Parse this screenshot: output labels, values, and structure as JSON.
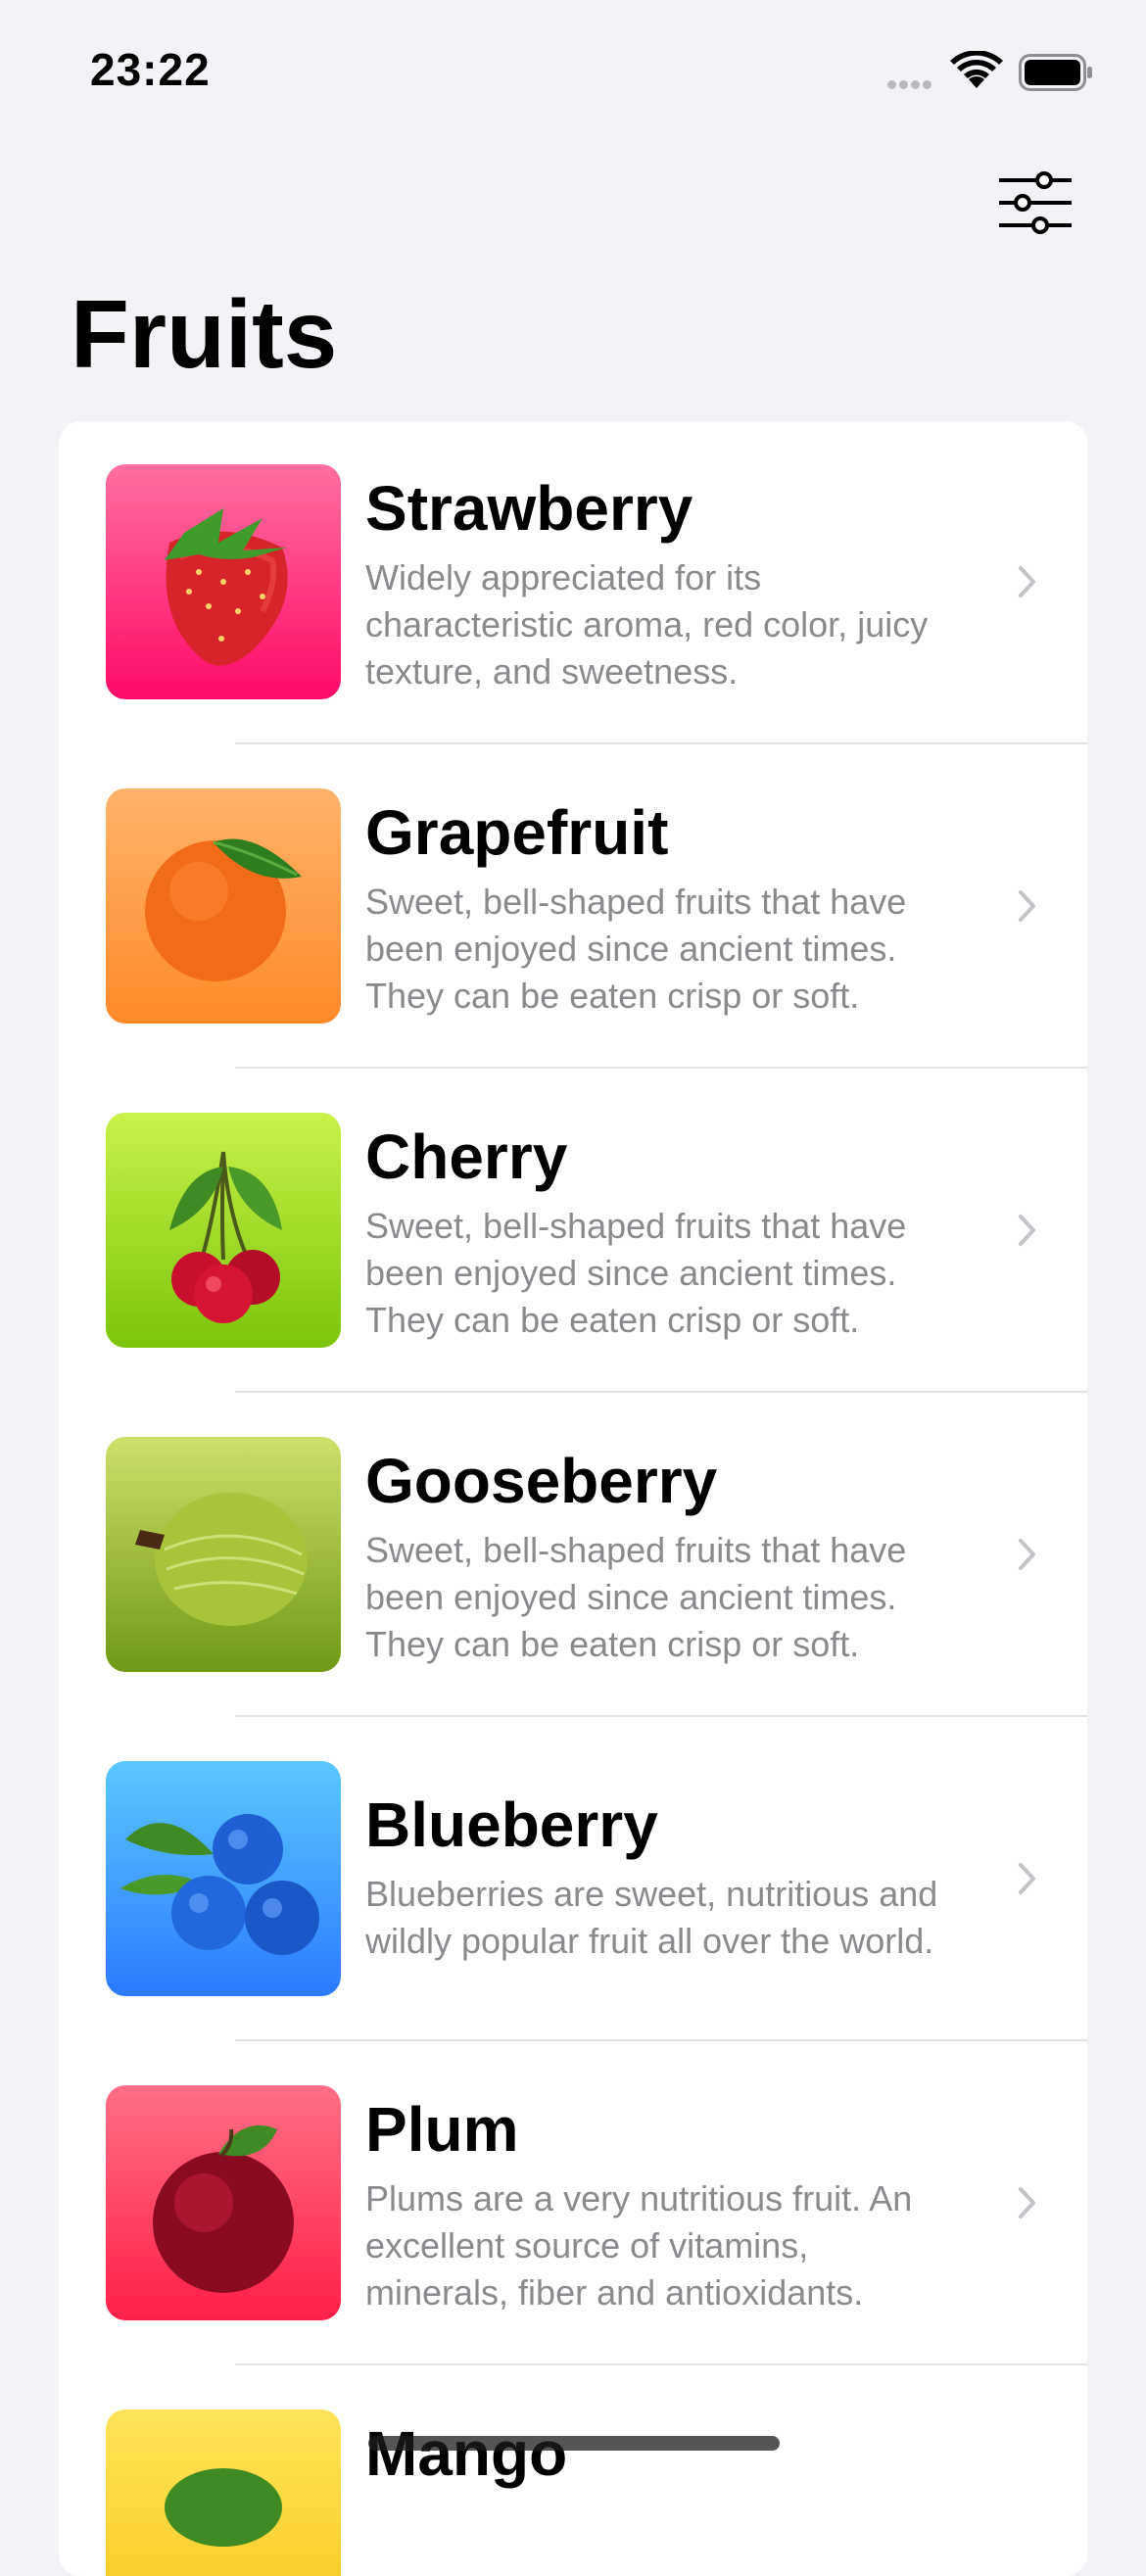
{
  "status_bar": {
    "time": "23:22"
  },
  "header": {
    "title": "Fruits",
    "filter_icon": "sliders-icon"
  },
  "accent_colors": {
    "strawberry": [
      "#ff6fa0",
      "#ff0a6a"
    ],
    "grapefruit": [
      "#ffb36a",
      "#ff8a2a"
    ],
    "cherry": [
      "#c8f24a",
      "#7cc40e"
    ],
    "gooseberry": [
      "#cde06a",
      "#6f9a14"
    ],
    "blueberry": [
      "#5bc8ff",
      "#2b7bff"
    ],
    "plum": [
      "#ff6f86",
      "#ff1f48"
    ],
    "mango": [
      "#ffe45a",
      "#f5c71a"
    ]
  },
  "fruits": [
    {
      "title": "Strawberry",
      "description": "Widely appreciated for its characteristic aroma,  red color, juicy texture, and sweetness."
    },
    {
      "title": "Grapefruit",
      "description": "Sweet, bell-shaped fruits that have been enjoyed since ancient times. They can be eaten crisp or soft."
    },
    {
      "title": "Cherry",
      "description": "Sweet, bell-shaped fruits that have been enjoyed since ancient times. They can be eaten crisp or soft."
    },
    {
      "title": "Gooseberry",
      "description": "Sweet, bell-shaped fruits that have been enjoyed since ancient times. They can be eaten crisp or soft."
    },
    {
      "title": "Blueberry",
      "description": "Blueberries are sweet, nutritious and wildly popular fruit all over the world."
    },
    {
      "title": "Plum",
      "description": "Plums are a very nutritious fruit. An excellent source of vitamins, minerals, fiber and antioxidants."
    },
    {
      "title": "Mango",
      "description": ""
    }
  ]
}
